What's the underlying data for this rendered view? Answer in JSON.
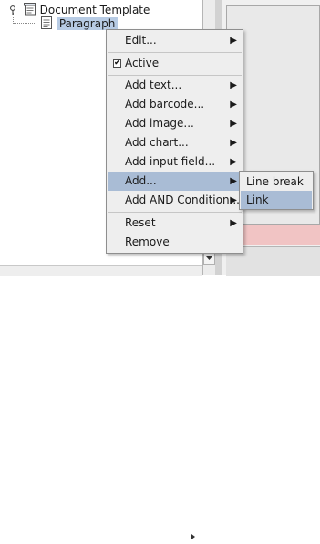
{
  "tree": {
    "root": {
      "label": "Document Template",
      "icon": "document-template-icon"
    },
    "child": {
      "label": "Paragraph",
      "icon": "paragraph-icon"
    }
  },
  "context_menu": {
    "items": [
      {
        "label": "Edit...",
        "submenu": true
      },
      {
        "label": "Active",
        "checked": true
      },
      {
        "label": "Add text...",
        "submenu": true
      },
      {
        "label": "Add barcode...",
        "submenu": true
      },
      {
        "label": "Add image...",
        "submenu": true
      },
      {
        "label": "Add chart...",
        "submenu": true
      },
      {
        "label": "Add input field...",
        "submenu": true
      },
      {
        "label": "Add...",
        "submenu": true,
        "highlighted": true
      },
      {
        "label": "Add AND Condition...",
        "submenu": true
      },
      {
        "label": "Reset",
        "submenu": true
      },
      {
        "label": "Remove"
      }
    ],
    "submenu_arrow": "▶"
  },
  "add_submenu": {
    "items": [
      {
        "label": "Line break"
      },
      {
        "label": "Link",
        "highlighted": true
      }
    ]
  },
  "checkmark": "✔",
  "colors": {
    "selection": "#b7cbe4",
    "menu_highlight": "#a9bcd5",
    "menu_background": "#eeeeee",
    "right_panel_pink": "#f1c4c4"
  }
}
